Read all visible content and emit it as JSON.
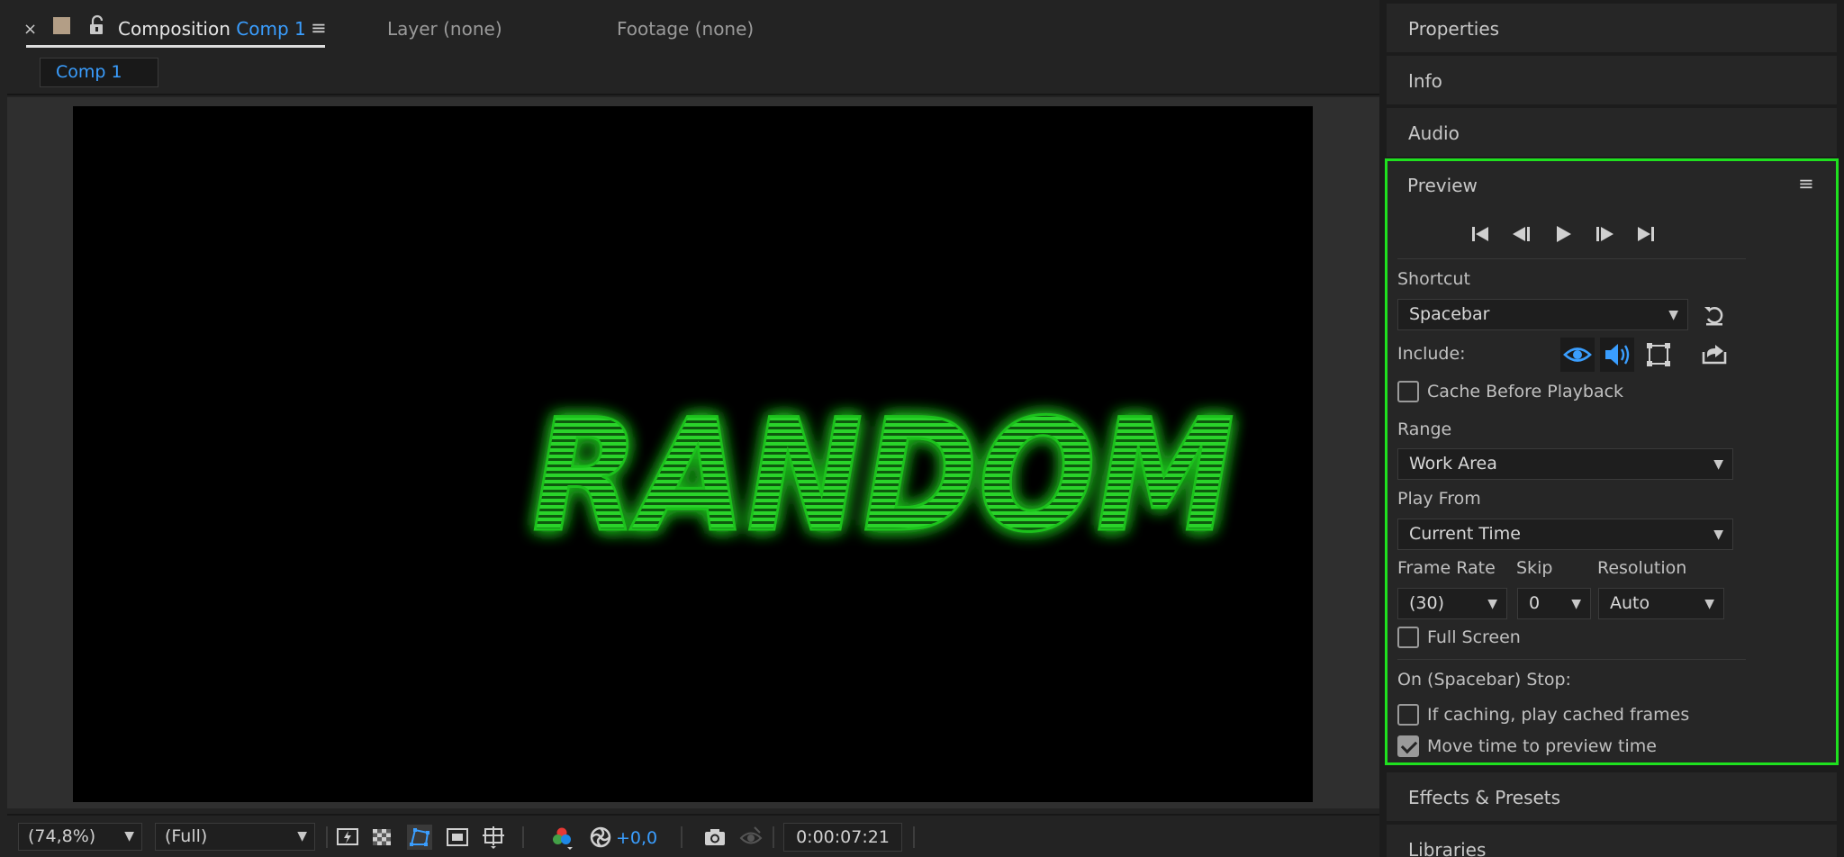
{
  "comp_panel": {
    "close_glyph": "×",
    "title_prefix": "Composition",
    "title_comp": "Comp 1",
    "menu_glyph": "≡",
    "layer_tab": "Layer (none)",
    "footage_tab": "Footage (none)",
    "comp_tab": "Comp 1",
    "canvas_text": "RANDOM",
    "canvas_text_color": "#1fc21f"
  },
  "footer": {
    "zoom": "(74,8%)",
    "resolution": "(Full)",
    "exposure": "+0,0",
    "timecode": "0:00:07:21",
    "icons": [
      "fast-preview-icon",
      "transparency-grid-icon",
      "mask-path-icon",
      "region-of-interest-icon",
      "grid-guides-icon",
      "color-channels-icon",
      "reset-exposure-icon",
      "snapshot-icon",
      "show-snapshot-icon"
    ]
  },
  "right_panels": {
    "properties": "Properties",
    "info": "Info",
    "audio": "Audio",
    "effects_presets": "Effects & Presets",
    "libraries": "Libraries"
  },
  "preview": {
    "title": "Preview",
    "menu_glyph": "≡",
    "shortcut_label": "Shortcut",
    "shortcut_value": "Spacebar",
    "include_label": "Include:",
    "cache_before_playback": "Cache Before Playback",
    "range_label": "Range",
    "range_value": "Work Area",
    "play_from_label": "Play From",
    "play_from_value": "Current Time",
    "frame_rate_label": "Frame Rate",
    "frame_rate_value": "(30)",
    "skip_label": "Skip",
    "skip_value": "0",
    "resolution_label": "Resolution",
    "resolution_value": "Auto",
    "full_screen": "Full Screen",
    "on_stop_label": "On (Spacebar) Stop:",
    "if_caching": "If caching, play cached frames",
    "move_time": "Move time to preview time",
    "checkbox_states": {
      "cache_before_playback": false,
      "full_screen": false,
      "if_caching": false,
      "move_time": true
    },
    "accent_color": "#3a9eff",
    "highlight_color": "#1fe01f"
  }
}
